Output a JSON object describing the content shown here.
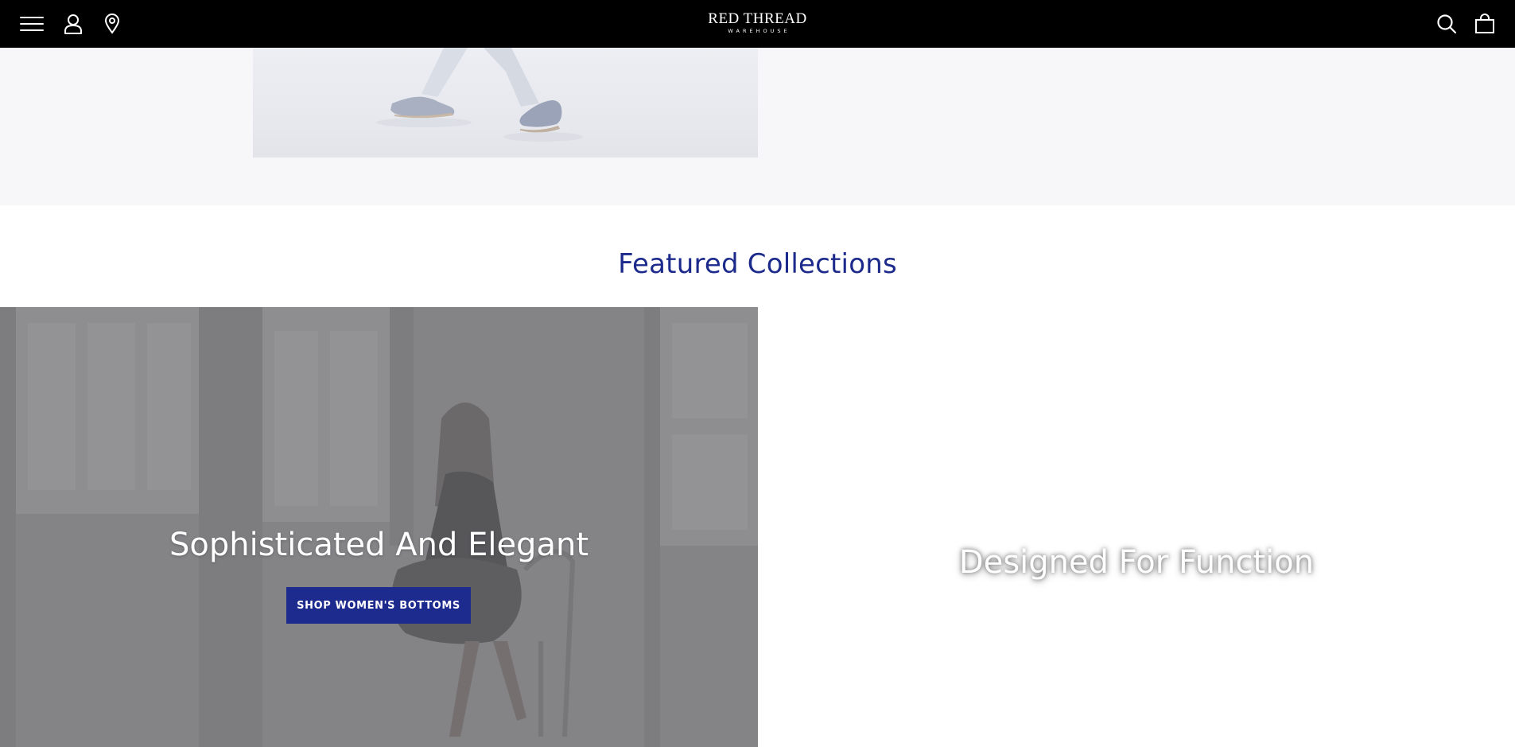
{
  "header": {
    "logo_main": "RED THREAD",
    "logo_sub": "WAREHOUSE",
    "icons": [
      "menu-icon",
      "account-icon",
      "location-pin-icon",
      "search-icon",
      "shopping-bag-icon"
    ]
  },
  "featured": {
    "title": "Featured Collections"
  },
  "collections": [
    {
      "title": "Sophisticated And Elegant",
      "button_label": "SHOP WOMEN'S BOTTOMS"
    },
    {
      "title": "Designed For Function"
    }
  ],
  "colors": {
    "header_bg": "#000000",
    "accent_blue": "#1e2b8e",
    "heading_blue": "#1c2a8c",
    "band_bg": "#f7f7f9"
  }
}
